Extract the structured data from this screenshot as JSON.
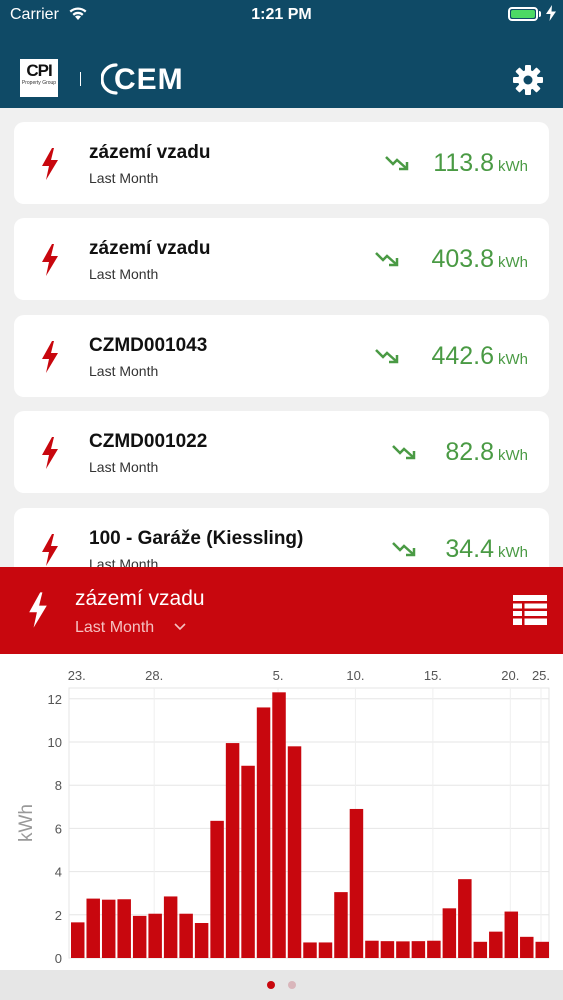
{
  "status_bar": {
    "carrier": "Carrier",
    "time": "1:21 PM"
  },
  "header": {
    "cpi_logo_big": "CPI",
    "cpi_logo_small": "Property Group",
    "cem_logo": "CEM",
    "settings_icon": "gear-icon"
  },
  "meters": [
    {
      "name": "zázemí vzadu",
      "period": "Last Month",
      "value": "113.8",
      "unit": "kWh",
      "trend": "down"
    },
    {
      "name": "zázemí vzadu",
      "period": "Last Month",
      "value": "403.8",
      "unit": "kWh",
      "trend": "down"
    },
    {
      "name": "CZMD001043",
      "period": "Last Month",
      "value": "442.6",
      "unit": "kWh",
      "trend": "down"
    },
    {
      "name": "CZMD001022",
      "period": "Last Month",
      "value": "82.8",
      "unit": "kWh",
      "trend": "down"
    },
    {
      "name": "100 - Garáže (Kiessling)",
      "period": "Last Month",
      "value": "34.4",
      "unit": "kWh",
      "trend": "down"
    }
  ],
  "detail": {
    "name": "zázemí vzadu",
    "period": "Last Month",
    "icon": "list-view-icon"
  },
  "colors": {
    "header": "#0f4a66",
    "accent": "#c8070e",
    "positive": "#4a9a44"
  },
  "chart_data": {
    "type": "bar",
    "ylabel": "kWh",
    "x_tick_labels": [
      "23.",
      "28.",
      "5.",
      "10.",
      "15.",
      "20.",
      "25."
    ],
    "y_ticks": [
      0,
      2,
      4,
      6,
      8,
      10,
      12
    ],
    "ylim": [
      0,
      12.5
    ],
    "grid": true,
    "values": [
      1.65,
      2.75,
      2.7,
      2.72,
      1.95,
      2.05,
      2.85,
      2.05,
      1.62,
      6.35,
      9.95,
      8.9,
      11.6,
      12.3,
      9.8,
      0.72,
      0.72,
      3.05,
      6.9,
      0.8,
      0.78,
      0.77,
      0.78,
      0.8,
      2.3,
      3.65,
      0.75,
      1.22,
      2.15,
      0.98,
      0.75
    ],
    "color": "#c8070e"
  },
  "pager": {
    "pages": 2,
    "active": 0
  }
}
